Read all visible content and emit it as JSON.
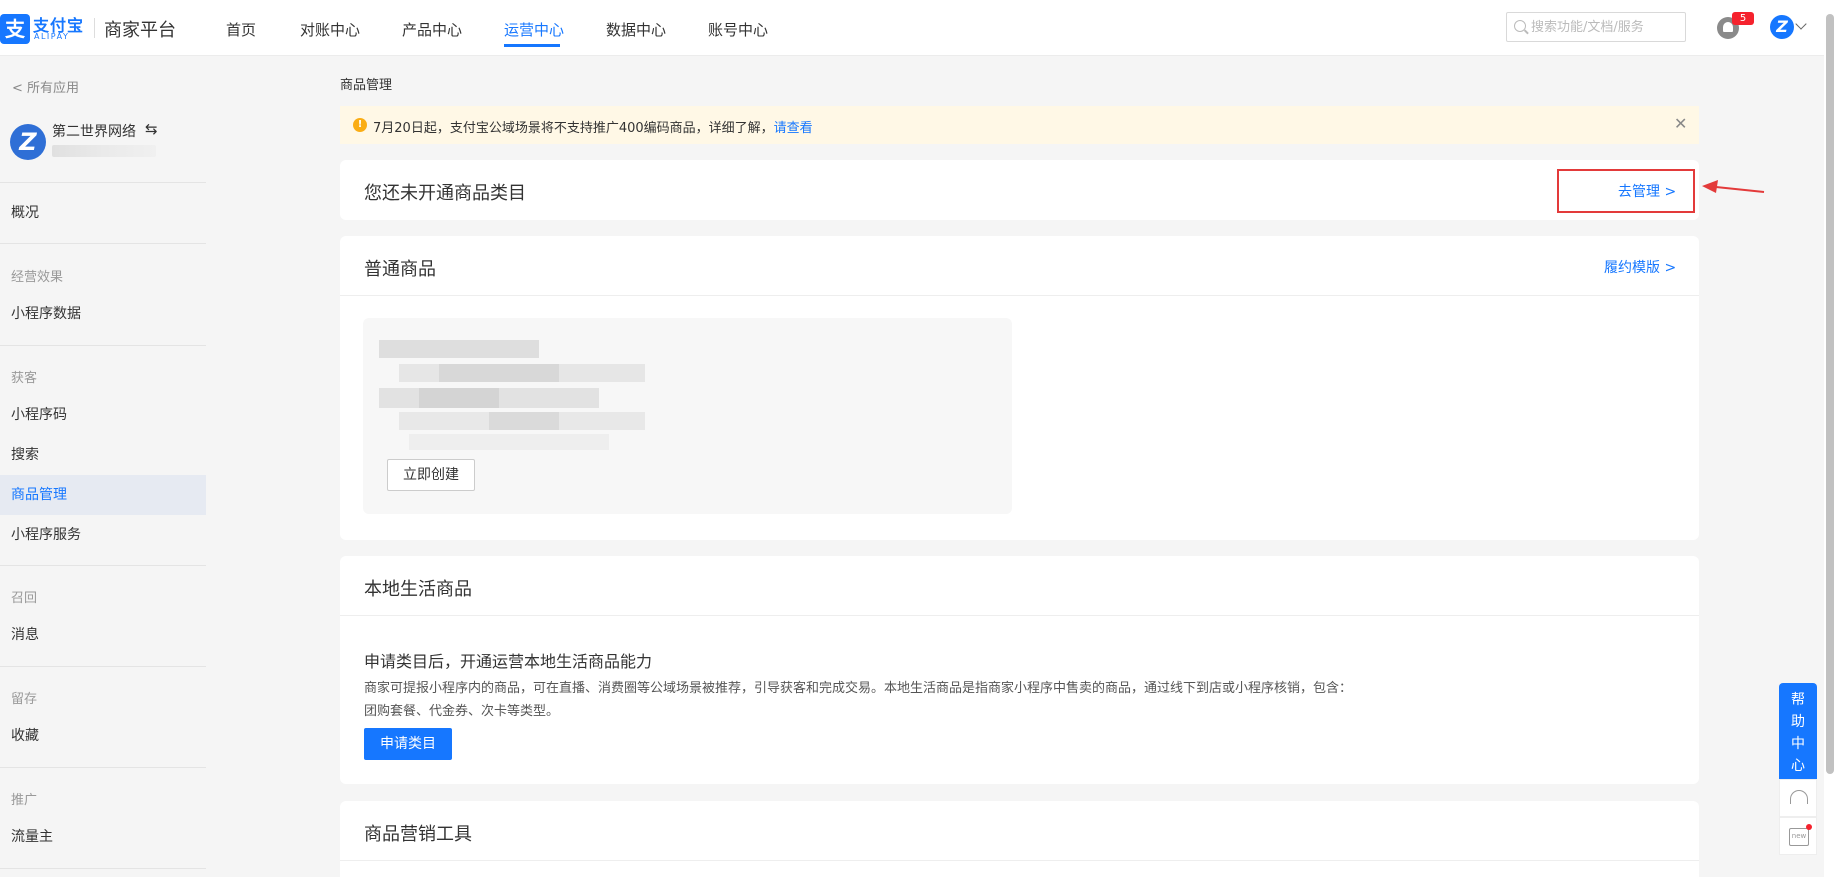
{
  "header": {
    "brand_cn": "支付宝",
    "brand_en": "ALIPAY",
    "platform": "商家平台",
    "nav": [
      {
        "label": "首页"
      },
      {
        "label": "对账中心"
      },
      {
        "label": "产品中心"
      },
      {
        "label": "运营中心"
      },
      {
        "label": "数据中心"
      },
      {
        "label": "账号中心"
      }
    ],
    "active_nav": "运营中心",
    "search_placeholder": "搜索功能/文档/服务",
    "notification_count": "5",
    "accent_color": "#1677ff"
  },
  "sidebar": {
    "back_label": "< 所有应用",
    "app_name": "第二世界网络",
    "swap_symbol": "⇆",
    "items": [
      {
        "label": "概况"
      },
      {
        "label": "小程序数据"
      },
      {
        "label": "小程序码"
      },
      {
        "label": "搜索"
      },
      {
        "label": "商品管理"
      },
      {
        "label": "小程序服务"
      },
      {
        "label": "消息"
      },
      {
        "label": "收藏"
      },
      {
        "label": "流量主"
      }
    ],
    "groups": [
      {
        "label": "经营效果"
      },
      {
        "label": "获客"
      },
      {
        "label": "召回"
      },
      {
        "label": "留存"
      },
      {
        "label": "推广"
      }
    ],
    "active_item": "商品管理"
  },
  "main": {
    "breadcrumb": "商品管理",
    "notice": {
      "icon": "!",
      "text": "7月20日起，支付宝公域场景将不支持推广400编码商品，详细了解，",
      "link": "请查看",
      "close": "✕"
    },
    "category_card": {
      "title": "您还未开通商品类目",
      "action": "去管理 >"
    },
    "normal_goods": {
      "title": "普通商品",
      "link": "履约模版 >",
      "create_button": "立即创建"
    },
    "local_goods": {
      "title": "本地生活商品",
      "subtitle": "申请类目后，开通运营本地生活商品能力",
      "description": "商家可提报小程序内的商品，可在直播、消费圈等公域场景被推荐，引导获客和完成交易。本地生活商品是指商家小程序中售卖的商品，通过线下到店或小程序核销，包含：团购套餐、代金券、次卡等类型。",
      "apply_button": "申请类目"
    },
    "marketing": {
      "title": "商品营销工具"
    }
  },
  "help": {
    "label": "帮助中心",
    "new_label": "new"
  }
}
